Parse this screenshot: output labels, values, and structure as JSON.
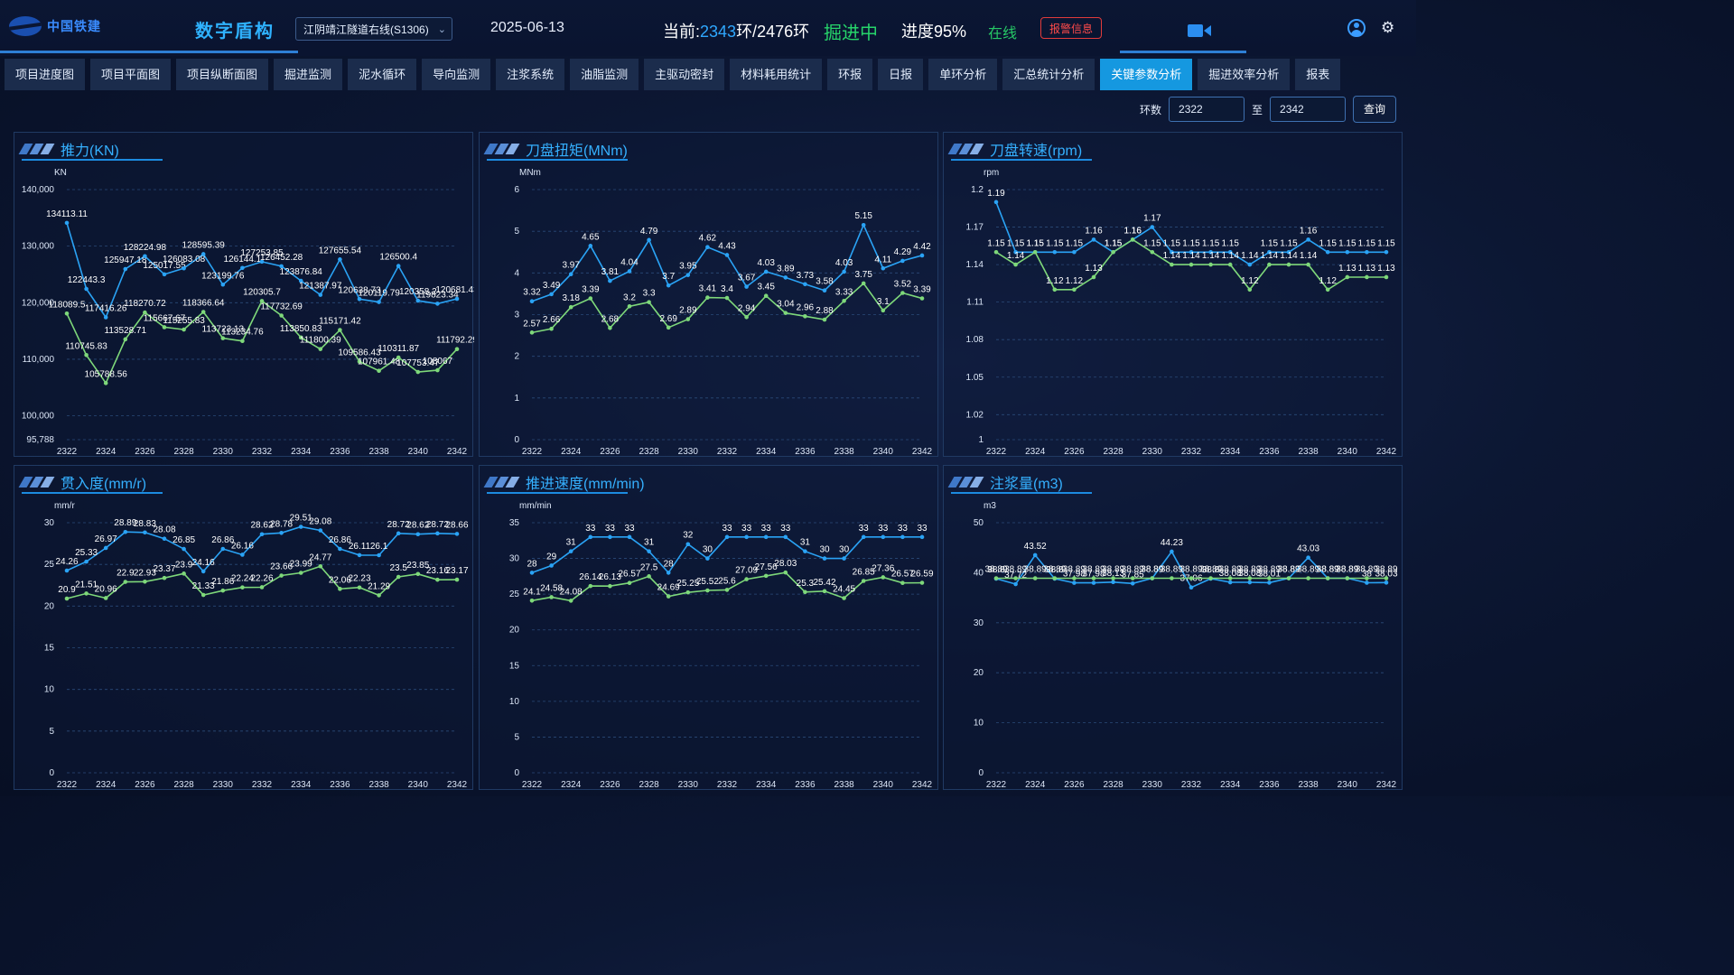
{
  "header": {
    "logo_text": "中国铁建",
    "system_title": "数字盾构",
    "project": "江阴靖江隧道右线(S1306)",
    "date": "2025-06-13",
    "ring_prefix": "当前:",
    "ring_current": "2343",
    "ring_suffix": "环/2476环",
    "status": "掘进中",
    "progress": "进度95%",
    "online": "在线",
    "alarm_label": "报警信息",
    "icons": [
      "camera-icon",
      "user-icon",
      "gear-icon"
    ]
  },
  "nav": {
    "tabs": [
      "项目进度图",
      "项目平面图",
      "项目纵断面图",
      "掘进监测",
      "泥水循环",
      "导向监测",
      "注浆系统",
      "油脂监测",
      "主驱动密封",
      "材料耗用统计",
      "环报",
      "日报",
      "单环分析",
      "汇总统计分析",
      "关键参数分析",
      "掘进效率分析",
      "报表"
    ],
    "active": "关键参数分析"
  },
  "query": {
    "ring_label": "环数",
    "from": "2322",
    "to_label": "至",
    "to": "2342",
    "button": "查询"
  },
  "colors": {
    "blue_series": "#2aa3f5",
    "green_series": "#7ed87a",
    "accent": "#1598e0",
    "alarm": "#e23b3b"
  },
  "chart_data": [
    {
      "type": "line",
      "title": "推力(KN)",
      "unit": "KN",
      "x": [
        2322,
        2323,
        2324,
        2325,
        2326,
        2327,
        2328,
        2329,
        2330,
        2331,
        2332,
        2333,
        2334,
        2335,
        2336,
        2337,
        2338,
        2339,
        2340,
        2341,
        2342
      ],
      "xticks": [
        "2322",
        "2324",
        "2326",
        "2328",
        "2330",
        "2332",
        "2334",
        "2336",
        "2338",
        "2340",
        "2342"
      ],
      "ylim": [
        95788,
        140000
      ],
      "yticks": [
        "95,788",
        "100,000",
        "110,000",
        "120,000",
        "130,000",
        "140,000"
      ],
      "series": [
        {
          "values": [
            134113.11,
            122443.3,
            117416.26,
            125947.18,
            128224.98,
            125017.55,
            126083.08,
            128595.39,
            123199.76,
            126144.1,
            127253.85,
            126452.28,
            123876.84,
            121387.97,
            127655.54,
            120638.73,
            120119.79,
            126500.4,
            120358.2,
            119823.34,
            120681.43
          ]
        },
        {
          "values": [
            118089.5,
            110745.83,
            105788.56,
            113528.71,
            118270.72,
            115667.67,
            115255.83,
            118366.64,
            113723.13,
            113234.76,
            120305.7,
            117732.69,
            113850.83,
            111800.39,
            115171.42,
            109586.43,
            107961.48,
            110311.87,
            107753.47,
            108067,
            111792.29
          ]
        }
      ]
    },
    {
      "type": "line",
      "title": "刀盘扭矩(MNm)",
      "unit": "MNm",
      "x": [
        2322,
        2323,
        2324,
        2325,
        2326,
        2327,
        2328,
        2329,
        2330,
        2331,
        2332,
        2333,
        2334,
        2335,
        2336,
        2337,
        2338,
        2339,
        2340,
        2341,
        2342
      ],
      "xticks": [
        "2322",
        "2324",
        "2326",
        "2328",
        "2330",
        "2332",
        "2334",
        "2336",
        "2338",
        "2340",
        "2342"
      ],
      "ylim": [
        0,
        6
      ],
      "yticks": [
        "0",
        "1",
        "2",
        "3",
        "4",
        "5",
        "6"
      ],
      "series": [
        {
          "values": [
            3.32,
            3.49,
            3.97,
            4.65,
            3.81,
            4.04,
            4.79,
            3.7,
            3.95,
            4.62,
            4.43,
            3.67,
            4.03,
            3.89,
            3.73,
            3.58,
            4.03,
            5.15,
            4.11,
            4.29,
            4.42
          ]
        },
        {
          "values": [
            2.57,
            2.66,
            3.18,
            3.39,
            2.68,
            3.2,
            3.3,
            2.69,
            2.89,
            3.41,
            3.4,
            2.94,
            3.45,
            3.04,
            2.96,
            2.88,
            3.33,
            3.75,
            3.1,
            3.52,
            3.39
          ]
        }
      ]
    },
    {
      "type": "line",
      "title": "刀盘转速(rpm)",
      "unit": "rpm",
      "x": [
        2322,
        2323,
        2324,
        2325,
        2326,
        2327,
        2328,
        2329,
        2330,
        2331,
        2332,
        2333,
        2334,
        2335,
        2336,
        2337,
        2338,
        2339,
        2340,
        2341,
        2342
      ],
      "xticks": [
        "2322",
        "2324",
        "2326",
        "2328",
        "2330",
        "2332",
        "2334",
        "2336",
        "2338",
        "2340",
        "2342"
      ],
      "ylim": [
        1,
        1.2
      ],
      "yticks": [
        "1",
        "1.02",
        "1.05",
        "1.08",
        "1.11",
        "1.14",
        "1.17",
        "1.2"
      ],
      "series": [
        {
          "values": [
            1.19,
            1.15,
            1.15,
            1.15,
            1.15,
            1.16,
            1.15,
            1.16,
            1.17,
            1.15,
            1.15,
            1.15,
            1.15,
            1.14,
            1.15,
            1.15,
            1.16,
            1.15,
            1.15,
            1.15,
            1.15
          ]
        },
        {
          "values": [
            1.15,
            1.14,
            1.15,
            1.12,
            1.12,
            1.13,
            1.15,
            1.16,
            1.15,
            1.14,
            1.14,
            1.14,
            1.14,
            1.12,
            1.14,
            1.14,
            1.14,
            1.12,
            1.13,
            1.13,
            1.13
          ]
        }
      ]
    },
    {
      "type": "line",
      "title": "贯入度(mm/r)",
      "unit": "mm/r",
      "x": [
        2322,
        2323,
        2324,
        2325,
        2326,
        2327,
        2328,
        2329,
        2330,
        2331,
        2332,
        2333,
        2334,
        2335,
        2336,
        2337,
        2338,
        2339,
        2340,
        2341,
        2342
      ],
      "xticks": [
        "2322",
        "2324",
        "2326",
        "2328",
        "2330",
        "2332",
        "2334",
        "2336",
        "2338",
        "2340",
        "2342"
      ],
      "ylim": [
        0,
        30
      ],
      "yticks": [
        "0",
        "5",
        "10",
        "15",
        "20",
        "25",
        "30"
      ],
      "series": [
        {
          "values": [
            24.26,
            25.33,
            26.97,
            28.89,
            28.83,
            28.08,
            26.85,
            24.16,
            26.86,
            26.16,
            28.62,
            28.78,
            29.51,
            29.08,
            26.86,
            26.11,
            26.1,
            28.72,
            28.62,
            28.72,
            28.66
          ]
        },
        {
          "values": [
            20.9,
            21.51,
            20.96,
            22.9,
            22.93,
            23.37,
            23.9,
            21.33,
            21.86,
            22.24,
            22.26,
            23.66,
            23.99,
            24.77,
            22.06,
            22.23,
            21.29,
            23.5,
            23.85,
            23.16,
            23.17
          ]
        }
      ]
    },
    {
      "type": "line",
      "title": "推进速度(mm/min)",
      "unit": "mm/min",
      "x": [
        2322,
        2323,
        2324,
        2325,
        2326,
        2327,
        2328,
        2329,
        2330,
        2331,
        2332,
        2333,
        2334,
        2335,
        2336,
        2337,
        2338,
        2339,
        2340,
        2341,
        2342
      ],
      "xticks": [
        "2322",
        "2324",
        "2326",
        "2328",
        "2330",
        "2332",
        "2334",
        "2336",
        "2338",
        "2340",
        "2342"
      ],
      "ylim": [
        0,
        35
      ],
      "yticks": [
        "0",
        "5",
        "10",
        "15",
        "20",
        "25",
        "30",
        "35"
      ],
      "series": [
        {
          "values": [
            28,
            29,
            31,
            33,
            33,
            33,
            31,
            28,
            32,
            30,
            33,
            33,
            33,
            33,
            31,
            30,
            30,
            33,
            33,
            33,
            33
          ]
        },
        {
          "values": [
            24.1,
            24.58,
            24.08,
            26.14,
            26.13,
            26.57,
            27.5,
            24.69,
            25.25,
            25.52,
            25.6,
            27.09,
            27.56,
            28.03,
            25.3,
            25.42,
            24.45,
            26.85,
            27.36,
            26.57,
            26.59
          ]
        }
      ]
    },
    {
      "type": "line",
      "title": "注浆量(m3)",
      "unit": "m3",
      "x": [
        2322,
        2323,
        2324,
        2325,
        2326,
        2327,
        2328,
        2329,
        2330,
        2331,
        2332,
        2333,
        2334,
        2335,
        2336,
        2337,
        2338,
        2339,
        2340,
        2341,
        2342
      ],
      "xticks": [
        "2322",
        "2324",
        "2326",
        "2328",
        "2330",
        "2332",
        "2334",
        "2336",
        "2338",
        "2340",
        "2342"
      ],
      "ylim": [
        0,
        50
      ],
      "yticks": [
        "0",
        "10",
        "20",
        "30",
        "40",
        "50"
      ],
      "series": [
        {
          "values": [
            38.8,
            37.72,
            43.52,
            38.8,
            37.98,
            37.98,
            38.13,
            37.85,
            38.89,
            44.23,
            37.06,
            38.8,
            38.08,
            38.08,
            38.01,
            38.89,
            43.03,
            38.89,
            38.89,
            38.0,
            38.03
          ]
        },
        {
          "values": [
            38.89,
            38.89,
            38.89,
            38.89,
            38.89,
            38.89,
            38.89,
            38.89,
            38.89,
            38.89,
            38.89,
            38.89,
            38.89,
            38.89,
            38.89,
            38.89,
            38.89,
            38.89,
            38.89,
            38.89,
            38.89
          ]
        }
      ]
    }
  ]
}
